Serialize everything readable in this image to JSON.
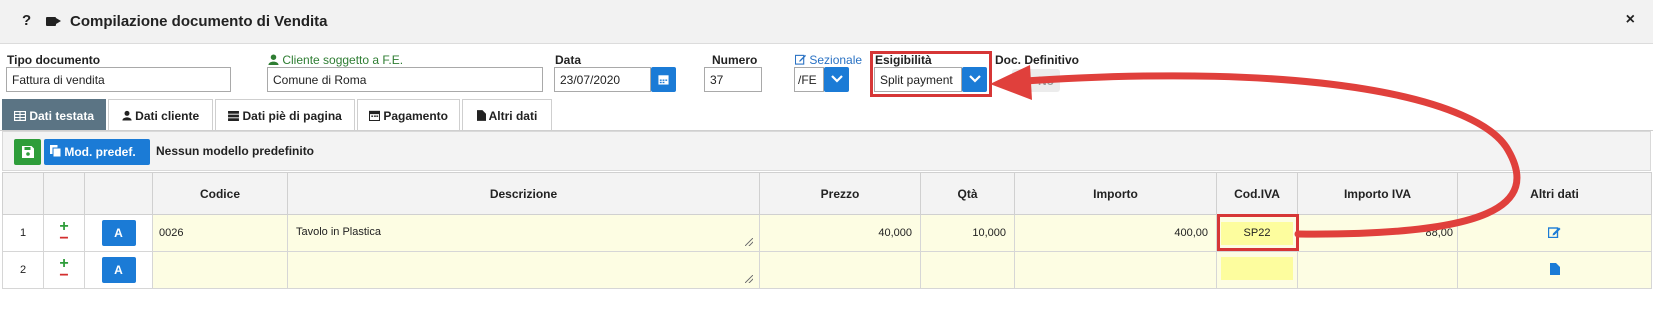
{
  "window": {
    "help_glyph": "?",
    "title": "Compilazione documento di Vendita",
    "close_glyph": "×"
  },
  "form": {
    "tipo_documento": {
      "label": "Tipo documento",
      "value": "Fattura di vendita"
    },
    "cliente": {
      "label": "Cliente soggetto a F.E.",
      "value": "Comune di Roma"
    },
    "data": {
      "label": "Data",
      "value": "23/07/2020"
    },
    "numero": {
      "label": "Numero",
      "value": "37"
    },
    "sezionale": {
      "label": "Sezionale",
      "value": "/FE"
    },
    "esigibilita": {
      "label": "Esigibilità",
      "value": "Split payment"
    },
    "doc_definitivo": {
      "label": "Doc. Definitivo",
      "value": "No"
    }
  },
  "tabs": [
    {
      "label": "Dati testata",
      "icon": "table-icon",
      "active": true
    },
    {
      "label": "Dati cliente",
      "icon": "user-icon",
      "active": false
    },
    {
      "label": "Dati piè di pagina",
      "icon": "server-icon",
      "active": false
    },
    {
      "label": "Pagamento",
      "icon": "calendar-icon",
      "active": false
    },
    {
      "label": "Altri dati",
      "icon": "file-icon",
      "active": false
    }
  ],
  "toolbar": {
    "model_button_label": "Mod. predef.",
    "model_status": "Nessun modello predefinito"
  },
  "table": {
    "headers": [
      "",
      "",
      "",
      "Codice",
      "Descrizione",
      "Prezzo",
      "Qtà",
      "Importo",
      "Cod.IVA",
      "Importo IVA",
      "Altri dati"
    ],
    "rows": [
      {
        "num": "1",
        "button": "A",
        "codice": "0026",
        "descrizione": "Tavolo in Plastica",
        "prezzo": "40,000",
        "qta": "10,000",
        "importo": "400,00",
        "cod_iva": "SP22",
        "importo_iva": "88,00"
      },
      {
        "num": "2",
        "button": "A",
        "codice": "",
        "descrizione": "",
        "prezzo": "",
        "qta": "",
        "importo": "",
        "cod_iva": "",
        "importo_iva": ""
      }
    ]
  },
  "colors": {
    "accent_blue": "#1b7bd6",
    "active_tab": "#5b7484",
    "save_green": "#2e9d3a",
    "highlight_red": "#d63636",
    "row_yellow": "#fdfde3"
  }
}
